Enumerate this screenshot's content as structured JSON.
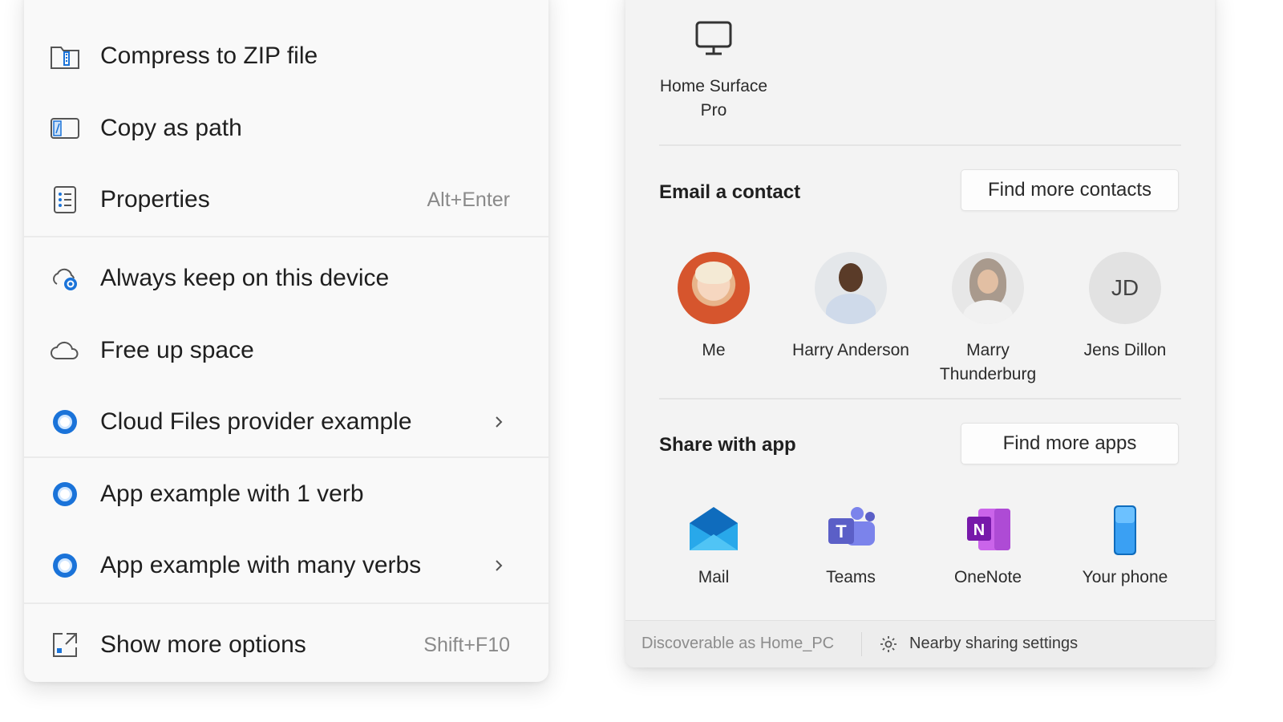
{
  "context_menu": {
    "items": [
      {
        "label": "Compress to ZIP file",
        "icon": "zip-folder-icon",
        "shortcut": "",
        "submenu": false
      },
      {
        "label": "Copy as path",
        "icon": "copy-path-icon",
        "shortcut": "",
        "submenu": false
      },
      {
        "label": "Properties",
        "icon": "properties-icon",
        "shortcut": "Alt+Enter",
        "submenu": false
      },
      {
        "label": "Always keep on this device",
        "icon": "cloud-sync-icon",
        "shortcut": "",
        "submenu": false
      },
      {
        "label": "Free up space",
        "icon": "cloud-icon",
        "shortcut": "",
        "submenu": false
      },
      {
        "label": "Cloud Files provider example",
        "icon": "app-ring-icon",
        "shortcut": "",
        "submenu": true
      },
      {
        "label": "App example with 1 verb",
        "icon": "app-ring-icon",
        "shortcut": "",
        "submenu": false
      },
      {
        "label": "App example with many verbs",
        "icon": "app-ring-icon",
        "shortcut": "",
        "submenu": true
      },
      {
        "label": "Show more options",
        "icon": "show-more-icon",
        "shortcut": "Shift+F10",
        "submenu": false
      }
    ]
  },
  "share_panel": {
    "device": {
      "name": "Home Surface Pro",
      "icon": "monitor-icon"
    },
    "email_section": {
      "title": "Email a contact",
      "button": "Find more contacts",
      "contacts": [
        {
          "name": "Me",
          "initials": ""
        },
        {
          "name": "Harry Anderson",
          "initials": ""
        },
        {
          "name": "Marry Thunderburg",
          "initials": ""
        },
        {
          "name": "Jens Dillon",
          "initials": "JD"
        }
      ]
    },
    "apps_section": {
      "title": "Share with app",
      "button": "Find more apps",
      "apps": [
        {
          "name": "Mail",
          "icon": "mail-icon"
        },
        {
          "name": "Teams",
          "icon": "teams-icon"
        },
        {
          "name": "OneNote",
          "icon": "onenote-icon"
        },
        {
          "name": "Your phone",
          "icon": "phone-icon"
        }
      ]
    },
    "footer": {
      "discoverable": "Discoverable as Home_PC",
      "settings_label": "Nearby sharing settings",
      "settings_icon": "gear-icon"
    }
  },
  "colors": {
    "accent_blue": "#1a73d9",
    "teams_purple": "#5b5fc7",
    "onenote_purple": "#7b2fbf"
  }
}
